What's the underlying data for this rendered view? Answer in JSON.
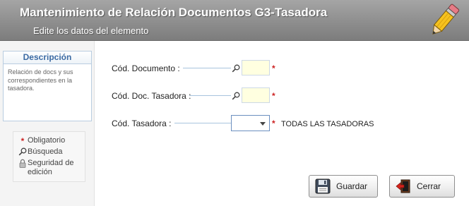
{
  "header": {
    "title": "Mantenimiento de Relación Documentos G3-Tasadora",
    "subtitle": "Edite los datos del elemento",
    "logo_icon": "pencil-icon"
  },
  "sidebar": {
    "description_title": "Descripción",
    "description_text": "Relación de docs y sus correspondientes en la tasadora.",
    "legend": {
      "required_symbol": "*",
      "required_label": "Obligatorio",
      "search_label": "Búsqueda",
      "security_label": "Seguridad de edición"
    }
  },
  "form": {
    "cod_documento": {
      "label": "Cód. Documento :",
      "value": "",
      "required_mark": "*"
    },
    "cod_doc_tasadora": {
      "label": "Cód. Doc. Tasadora :",
      "value": "",
      "required_mark": "*"
    },
    "cod_tasadora": {
      "label": "Cód. Tasadora :",
      "selected_value": "",
      "required_mark": "*",
      "description": "TODAS LAS TASADORAS"
    }
  },
  "buttons": {
    "save_label": "Guardar",
    "close_label": "Cerrar"
  },
  "colors": {
    "header_bg": "#8e8e8e",
    "required": "#cc2222",
    "input_bg": "#ffffe0",
    "accent": "#3b6aa3"
  }
}
